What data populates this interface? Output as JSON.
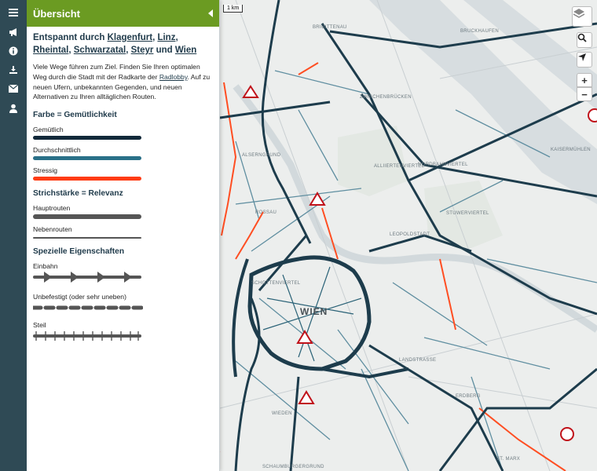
{
  "panel": {
    "title": "Übersicht",
    "heading_prefix": "Entspannt durch ",
    "heading_city1": "Klagenfurt",
    "heading_sep1": ", ",
    "heading_city2": "Linz",
    "heading_sep2": ", ",
    "heading_city3": "Rheintal",
    "heading_sep3": ", ",
    "heading_city4": "Schwarzatal",
    "heading_sep4": ", ",
    "heading_city5": "Steyr",
    "heading_sep5": " und ",
    "heading_city6": "Wien",
    "intro_part1": "Viele Wege führen zum Ziel. Finden Sie Ihren optimalen Weg durch die Stadt mit der Radkarte der ",
    "intro_link": "Radlobby",
    "intro_part2": ". Auf zu neuen Ufern, unbekannten Gegenden, und neuen Alternativen zu Ihren alltäglichen Routen.",
    "section_color": "Farbe = Gemütlichkeit",
    "legend_comfy": "Gemütlich",
    "legend_medium": "Durchschnittlich",
    "legend_stress": "Stressig",
    "section_width": "Strichstärke = Relevanz",
    "legend_main": "Hauptrouten",
    "legend_side": "Nebenrouten",
    "section_special": "Spezielle Eigenschaften",
    "legend_oneway": "Einbahn",
    "legend_unpaved": "Unbefestigt (oder sehr uneben)",
    "legend_steep": "Steil"
  },
  "colors": {
    "header_green": "#6b9b22",
    "comfy": "#12293a",
    "medium": "#2a7088",
    "stress": "#ff3c14",
    "relevance": "#555555",
    "strip": "#2f4a55"
  },
  "icons": {
    "menu": "menu-icon",
    "announce": "megaphone-icon",
    "info": "info-icon",
    "download": "download-icon",
    "mail": "mail-icon",
    "user": "user-icon"
  },
  "map": {
    "scale": "1 km",
    "city": "WIEN",
    "labels": {
      "brigittenau": "BRIGITTENAU",
      "bruckhaufen": "BRUCKHAUFEN",
      "zwischenbruecken": "ZWISCHENBRÜCKEN",
      "alliiertenviertel": "ALLIIERTENVIERTEL",
      "nordbahnviertel": "NORDBAHNVIERTEL",
      "kaisermuehlen": "KAISERMÜHLEN",
      "alserngrund": "ALSERNGRUND",
      "rossau": "ROSSAU",
      "stuwerviertel": "STUWERVIERTEL",
      "leopoldstadt": "LEOPOLDSTADT",
      "schottenviertel": "SCHOTTENVIERTEL",
      "landstrasse": "LANDSTRASSE",
      "wieden": "WIEDEN",
      "erdberg": "ERDBERG",
      "stmarx": "ST. MARX",
      "schaumburgergrund": "SCHAUMBURGERGRUND"
    }
  },
  "controls": {
    "zoom_in": "+",
    "zoom_out": "−"
  }
}
